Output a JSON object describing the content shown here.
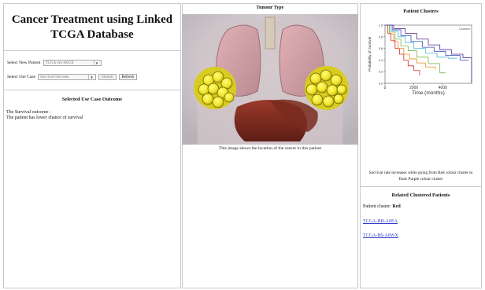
{
  "app": {
    "title": "Cancer Treatment using Linked TCGA Database"
  },
  "controls": {
    "new_patient_label": "Select New Patient",
    "new_patient_value": "TCGA-A2-A0CX",
    "use_case_label": "Select Use Case",
    "use_case_value": "Survival Outcome",
    "submit_label": "Submit",
    "refresh_label": "Refresh"
  },
  "outcome": {
    "heading": "Selected Use Case Outcome",
    "line1": "The Survival outcome :",
    "line2": "The patient has lower chance of survival"
  },
  "tumour": {
    "heading": "Tumour Type",
    "caption": "This image shows the location of the cancer in this patient"
  },
  "clusters": {
    "heading": "Patient Clusters",
    "ylabel": "Probability of Survival",
    "xlabel": "Time (months)",
    "x_ticks": [
      "0",
      "2000",
      "4000"
    ],
    "y_ticks": [
      "0.0",
      "0.2",
      "0.4",
      "0.6",
      "0.8",
      "1.0"
    ],
    "legend": "Clusters",
    "note": "Survival rate increases while going from Red colour cluster to Dark Purple colour cluster"
  },
  "related": {
    "heading": "Related Clustered Patients",
    "cluster_label": "Patient cluster:",
    "cluster_value": "Red",
    "patients": [
      "TCGA-BH-A0EA",
      "TCGA-B6-A0WX"
    ]
  },
  "colors": {
    "link": "#2e37c9",
    "cluster_red": "#d22a2a",
    "cluster_orange": "#f08a1c",
    "cluster_green": "#7ab648",
    "cluster_cyan": "#4fb7d8",
    "cluster_blue": "#3550b8",
    "cluster_purple": "#5a2a8a"
  },
  "chart_data": {
    "type": "line",
    "title": "Patient Clusters",
    "xlabel": "Time (months)",
    "ylabel": "Probability of Survival",
    "xlim": [
      0,
      6000
    ],
    "ylim": [
      0,
      1
    ],
    "series": [
      {
        "name": "",
        "x": [
          0,
          200,
          400,
          700,
          1000,
          1300,
          1600,
          2000,
          2400
        ],
        "y": [
          1.0,
          0.86,
          0.74,
          0.6,
          0.5,
          0.4,
          0.3,
          0.22,
          0.14
        ]
      },
      {
        "name": "",
        "x": [
          0,
          300,
          600,
          900,
          1300,
          1700,
          2200,
          2800,
          3500
        ],
        "y": [
          1.0,
          0.85,
          0.72,
          0.6,
          0.5,
          0.42,
          0.35,
          0.28,
          0.24
        ]
      },
      {
        "name": "",
        "x": [
          0,
          300,
          700,
          1100,
          1600,
          2200,
          3000,
          3800,
          4200
        ],
        "y": [
          1.0,
          0.88,
          0.76,
          0.64,
          0.56,
          0.45,
          0.34,
          0.18,
          0.18
        ]
      },
      {
        "name": "",
        "x": [
          0,
          400,
          900,
          1400,
          2000,
          2800,
          3600,
          4400,
          5000
        ],
        "y": [
          1.0,
          0.9,
          0.8,
          0.7,
          0.6,
          0.52,
          0.45,
          0.43,
          0.43
        ]
      },
      {
        "name": "",
        "x": [
          0,
          500,
          1100,
          1800,
          2600,
          3400,
          4200,
          5200,
          5800
        ],
        "y": [
          1.0,
          0.92,
          0.82,
          0.72,
          0.62,
          0.55,
          0.48,
          0.4,
          0.4
        ]
      },
      {
        "name": "",
        "x": [
          0,
          600,
          1400,
          2200,
          3000,
          3800,
          4600,
          5400,
          6000
        ],
        "y": [
          1.0,
          0.94,
          0.86,
          0.76,
          0.66,
          0.58,
          0.5,
          0.44,
          0.0
        ]
      }
    ]
  }
}
